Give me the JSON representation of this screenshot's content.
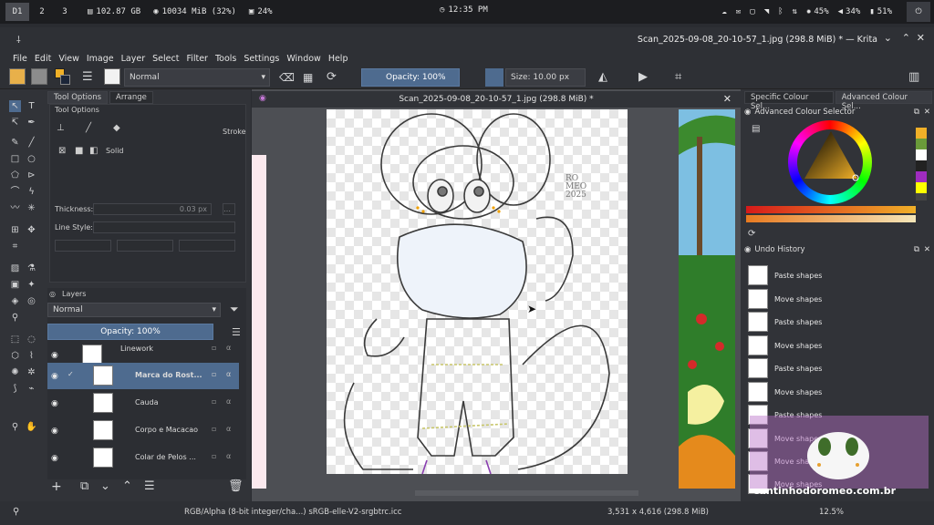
{
  "system_bar": {
    "workspaces": [
      "D1",
      "2",
      "3"
    ],
    "disk": "102.87 GB",
    "memory": "10034 MiB (32%)",
    "cpu": "24%",
    "clock": "12:35 PM",
    "brightness": "45%",
    "volume": "34%",
    "battery": "51%"
  },
  "window": {
    "title": "Scan_2025-09-08_20-10-57_1.jpg (298.8 MiB) * — Krita"
  },
  "menu": [
    "File",
    "Edit",
    "View",
    "Image",
    "Layer",
    "Select",
    "Filter",
    "Tools",
    "Settings",
    "Window",
    "Help"
  ],
  "toolbar": {
    "blend_mode": "Normal",
    "opacity": "Opacity: 100%",
    "size": "Size: 10.00 px"
  },
  "tool_options": {
    "tabs": [
      "Tool Options",
      "Arrange"
    ],
    "header": "Tool Options",
    "stroke_label": "Stroke",
    "fill_label": "Solid",
    "thickness_label": "Thickness:",
    "thickness_value": "0.03 px",
    "line_style_label": "Line Style:"
  },
  "layers": {
    "header": "Layers",
    "blend_mode": "Normal",
    "opacity": "Opacity: 100%",
    "items": [
      {
        "name": "Linework"
      },
      {
        "name": "Marca do Rost..."
      },
      {
        "name": "Cauda"
      },
      {
        "name": "Corpo e Macacao"
      },
      {
        "name": "Colar de Pelos ..."
      }
    ]
  },
  "document": {
    "tab_title": "Scan_2025-09-08_20-10-57_1.jpg (298.8 MiB) *",
    "signature": "RO\nMEO\n2025"
  },
  "right_dock": {
    "tabs": [
      "Specific Colour Sel...",
      "Advanced Colour Sel..."
    ],
    "color_selector_title": "Advanced Colour Selector",
    "undo_title": "Undo History",
    "undo_items": [
      "Paste shapes",
      "Move shapes",
      "Paste shapes",
      "Move shapes",
      "Paste shapes",
      "Move shapes",
      "Paste shapes",
      "Move shapes",
      "Move shapes",
      "Move shapes"
    ]
  },
  "status": {
    "color_profile": "RGB/Alpha (8-bit integer/cha...)  sRGB-elle-V2-srgbtrc.icc",
    "dimensions": "3,531 x 4,616 (298.8 MiB)",
    "zoom": "12.5%"
  },
  "watermark": "cantinhodoromeo.com.br",
  "colors": {
    "accent": "#4e6b8f",
    "panel": "#313338",
    "canvas_bg": "#4d4f54"
  }
}
